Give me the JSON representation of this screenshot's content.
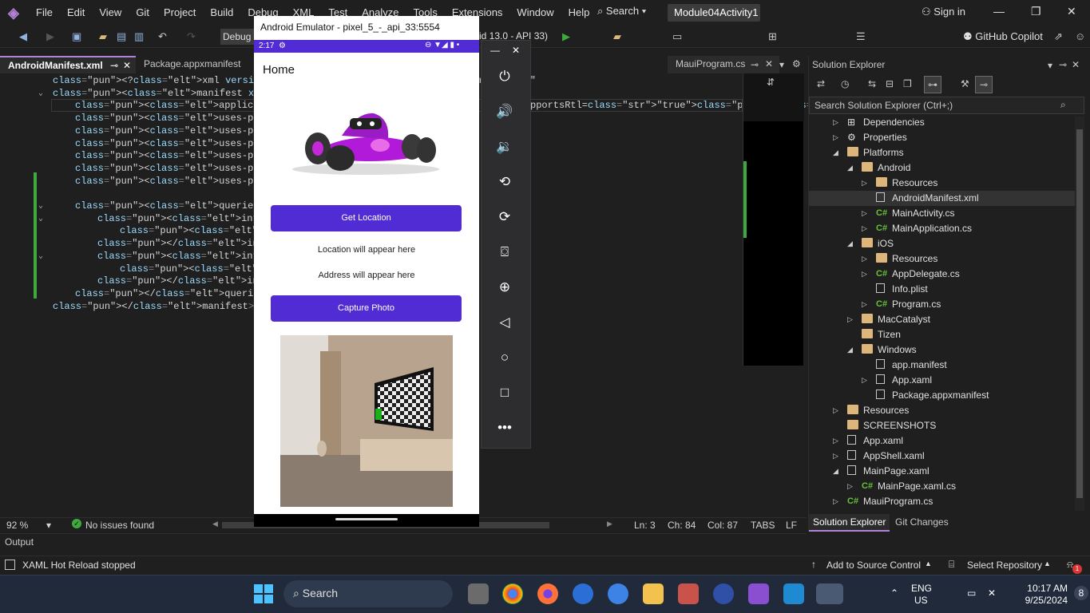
{
  "menubar": {
    "items": [
      "File",
      "Edit",
      "View",
      "Git",
      "Project",
      "Build",
      "Debug",
      "XML",
      "Test",
      "Analyze",
      "Tools",
      "Extensions",
      "Window",
      "Help"
    ],
    "search_label": "Search",
    "project_name": "Module04Activity1",
    "sign_in": "Sign in"
  },
  "toolbar": {
    "config": "Debug",
    "api_info": "id 13.0 - API 33)",
    "copilot": "GitHub Copilot"
  },
  "tabs": [
    {
      "label": "AndroidManifest.xml"
    },
    {
      "label": "Package.appxmanifest"
    },
    {
      "label": "MauiProgram.cs"
    }
  ],
  "editor": {
    "lines": [
      {
        "indent": 0,
        "text": "<?xml version=\"1.0\" encoding=\"utf-8\"",
        "kind": "decl"
      },
      {
        "indent": 0,
        "text": "<manifest xmlns:android=\"http://sche",
        "kind": "tag"
      },
      {
        "indent": 1,
        "text": "<application android:allowBackup",
        "kind": "tag",
        "tail": "pportsRtl=\"true\"></application>"
      },
      {
        "indent": 1,
        "text": "<uses-permission android:name=\"a",
        "kind": "tag"
      },
      {
        "indent": 1,
        "text": "<uses-permission android:name=\"a",
        "kind": "tag"
      },
      {
        "indent": 1,
        "text": "<uses-permission android:name=\"a",
        "kind": "tag"
      },
      {
        "indent": 1,
        "text": "<uses-permission android:name=\"a",
        "kind": "tag"
      },
      {
        "indent": 1,
        "text": "<uses-permission android:name=\"a",
        "kind": "tag"
      },
      {
        "indent": 1,
        "text": "<uses-permission android:name=\"a",
        "kind": "tag"
      },
      {
        "indent": 0,
        "text": "",
        "kind": "blank"
      },
      {
        "indent": 1,
        "text": "<queries>",
        "kind": "tag"
      },
      {
        "indent": 2,
        "text": "<intent>",
        "kind": "tag"
      },
      {
        "indent": 3,
        "text": "<action android:name=\"an",
        "kind": "tag"
      },
      {
        "indent": 2,
        "text": "</intent>",
        "kind": "tag"
      },
      {
        "indent": 2,
        "text": "<intent>",
        "kind": "tag"
      },
      {
        "indent": 3,
        "text": "<action android:name=\"an",
        "kind": "tag"
      },
      {
        "indent": 2,
        "text": "</intent>",
        "kind": "tag"
      },
      {
        "indent": 1,
        "text": "</queries>",
        "kind": "tag"
      },
      {
        "indent": 0,
        "text": "</manifest>",
        "kind": "tag"
      }
    ]
  },
  "statusline": {
    "zoom": "92 %",
    "issues": "No issues found",
    "ln": "Ln: 3",
    "ch": "Ch: 84",
    "col": "Col: 87",
    "tabs": "TABS",
    "eol": "LF"
  },
  "output": {
    "label": "Output"
  },
  "vsstatus": {
    "hot_reload": "XAML Hot Reload stopped",
    "source_control": "Add to Source Control",
    "select_repo": "Select Repository",
    "notif_count": "1"
  },
  "emulator": {
    "title": "Android Emulator - pixel_5_-_api_33:5554",
    "time": "2:17",
    "page_title": "Home",
    "get_location": "Get Location",
    "location_text": "Location will appear here",
    "address_text": "Address will appear here",
    "capture_photo": "Capture Photo"
  },
  "solution_explorer": {
    "title": "Solution Explorer",
    "search_placeholder": "Search Solution Explorer (Ctrl+;)",
    "items": [
      {
        "label": "Dependencies",
        "depth": 1,
        "arrow": "closed",
        "icon": "deps"
      },
      {
        "label": "Properties",
        "depth": 1,
        "arrow": "closed",
        "icon": "props"
      },
      {
        "label": "Platforms",
        "depth": 1,
        "arrow": "open",
        "icon": "folder"
      },
      {
        "label": "Android",
        "depth": 2,
        "arrow": "open",
        "icon": "folder"
      },
      {
        "label": "Resources",
        "depth": 3,
        "arrow": "closed",
        "icon": "folder"
      },
      {
        "label": "AndroidManifest.xml",
        "depth": 3,
        "arrow": "none",
        "icon": "xml",
        "selected": true
      },
      {
        "label": "MainActivity.cs",
        "depth": 3,
        "arrow": "closed",
        "icon": "cs"
      },
      {
        "label": "MainApplication.cs",
        "depth": 3,
        "arrow": "closed",
        "icon": "cs"
      },
      {
        "label": "iOS",
        "depth": 2,
        "arrow": "open",
        "icon": "folder"
      },
      {
        "label": "Resources",
        "depth": 3,
        "arrow": "closed",
        "icon": "folder"
      },
      {
        "label": "AppDelegate.cs",
        "depth": 3,
        "arrow": "closed",
        "icon": "cs"
      },
      {
        "label": "Info.plist",
        "depth": 3,
        "arrow": "none",
        "icon": "file"
      },
      {
        "label": "Program.cs",
        "depth": 3,
        "arrow": "closed",
        "icon": "cs"
      },
      {
        "label": "MacCatalyst",
        "depth": 2,
        "arrow": "closed",
        "icon": "folder"
      },
      {
        "label": "Tizen",
        "depth": 2,
        "arrow": "none",
        "icon": "folder"
      },
      {
        "label": "Windows",
        "depth": 2,
        "arrow": "open",
        "icon": "folder"
      },
      {
        "label": "app.manifest",
        "depth": 3,
        "arrow": "none",
        "icon": "xml"
      },
      {
        "label": "App.xaml",
        "depth": 3,
        "arrow": "closed",
        "icon": "xml"
      },
      {
        "label": "Package.appxmanifest",
        "depth": 3,
        "arrow": "none",
        "icon": "xml"
      },
      {
        "label": "Resources",
        "depth": 1,
        "arrow": "closed",
        "icon": "folder"
      },
      {
        "label": "SCREENSHOTS",
        "depth": 1,
        "arrow": "none",
        "icon": "folder"
      },
      {
        "label": "App.xaml",
        "depth": 1,
        "arrow": "closed",
        "icon": "xml"
      },
      {
        "label": "AppShell.xaml",
        "depth": 1,
        "arrow": "closed",
        "icon": "xml"
      },
      {
        "label": "MainPage.xaml",
        "depth": 1,
        "arrow": "open",
        "icon": "xml"
      },
      {
        "label": "MainPage.xaml.cs",
        "depth": 2,
        "arrow": "closed",
        "icon": "cs"
      },
      {
        "label": "MauiProgram.cs",
        "depth": 1,
        "arrow": "closed",
        "icon": "cs"
      }
    ],
    "bottom_tabs": [
      "Solution Explorer",
      "Git Changes"
    ]
  },
  "taskbar": {
    "search": "Search",
    "lang": "ENG",
    "region": "US",
    "time": "10:17 AM",
    "date": "9/25/2024",
    "notif": "8"
  },
  "colors": {
    "accent": "#512bd4",
    "vs_purple": "#b180d7",
    "git_green": "#3fa83f"
  }
}
